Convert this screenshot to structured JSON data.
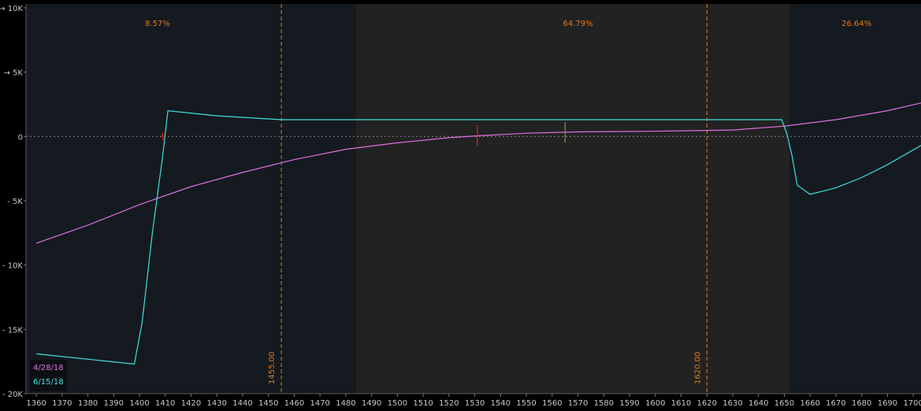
{
  "chart_data": {
    "type": "line",
    "x_ticks": [
      1360,
      1370,
      1380,
      1390,
      1400,
      1410,
      1420,
      1430,
      1440,
      1450,
      1460,
      1470,
      1480,
      1490,
      1500,
      1510,
      1520,
      1530,
      1540,
      1550,
      1560,
      1570,
      1580,
      1590,
      1600,
      1610,
      1620,
      1630,
      1640,
      1650,
      1660,
      1670,
      1680,
      1690,
      1700
    ],
    "y_ticks": [
      {
        "value": 10000,
        "label": "10K",
        "arrow": true
      },
      {
        "value": 5000,
        "label": "5K",
        "arrow": true
      },
      {
        "value": 0,
        "label": "0",
        "arrow": false
      },
      {
        "value": -5000,
        "label": "- 5K",
        "arrow": false
      },
      {
        "value": -10000,
        "label": "- 10K",
        "arrow": false
      },
      {
        "value": -15000,
        "label": "- 15K",
        "arrow": false
      },
      {
        "value": -20000,
        "label": "- 20K",
        "arrow": false
      }
    ],
    "xlim": [
      1356,
      1703
    ],
    "ylim": [
      -20000,
      10300
    ],
    "regions": [
      {
        "from": 1356,
        "to": 1484,
        "color": "#141a20",
        "label": "8.57%",
        "label_x": 1407
      },
      {
        "from": 1484,
        "to": 1652,
        "color": "#222222",
        "label": "64.79%",
        "label_x": 1570
      },
      {
        "from": 1652,
        "to": 1703,
        "color": "#141a20",
        "label": "26.64%",
        "label_x": 1678
      }
    ],
    "vlines": [
      {
        "x": 1455,
        "label": "1455.00"
      },
      {
        "x": 1620,
        "label": "1620.00"
      }
    ],
    "markers": [
      {
        "x": 1531,
        "color": "#ff2222"
      },
      {
        "x": 1565,
        "color": "#7ab648"
      }
    ],
    "series": [
      {
        "name": "4/28/18",
        "color": "#e070e0",
        "x": [
          1360,
          1380,
          1400,
          1420,
          1440,
          1460,
          1480,
          1500,
          1520,
          1531,
          1550,
          1570,
          1600,
          1630,
          1650,
          1670,
          1690,
          1703
        ],
        "y": [
          -8300,
          -6900,
          -5300,
          -3900,
          -2800,
          -1800,
          -1000,
          -500,
          -100,
          50,
          250,
          350,
          400,
          500,
          800,
          1300,
          2000,
          2600
        ]
      },
      {
        "name": "6/15/18",
        "color": "#40e0e0",
        "x": [
          1360,
          1398,
          1401,
          1405,
          1409,
          1411,
          1430,
          1455,
          1500,
          1600,
          1649,
          1651,
          1653,
          1655,
          1660,
          1670,
          1680,
          1690,
          1703
        ],
        "y": [
          -16900,
          -17700,
          -14500,
          -7500,
          -1500,
          2000,
          1600,
          1300,
          1300,
          1300,
          1300,
          200,
          -1500,
          -3800,
          -4500,
          -4000,
          -3200,
          -2200,
          -700
        ]
      }
    ]
  }
}
